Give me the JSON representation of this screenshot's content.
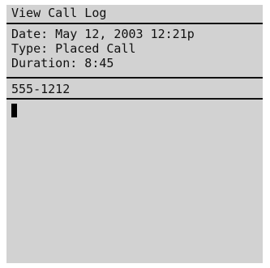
{
  "screen": {
    "title": "View Call Log",
    "details": {
      "date": "Date: May 12, 2003 12:21p",
      "type": "Type: Placed Call",
      "duration": "Duration: 8:45"
    },
    "phone_number": "555-1212",
    "note_field_value": ""
  }
}
